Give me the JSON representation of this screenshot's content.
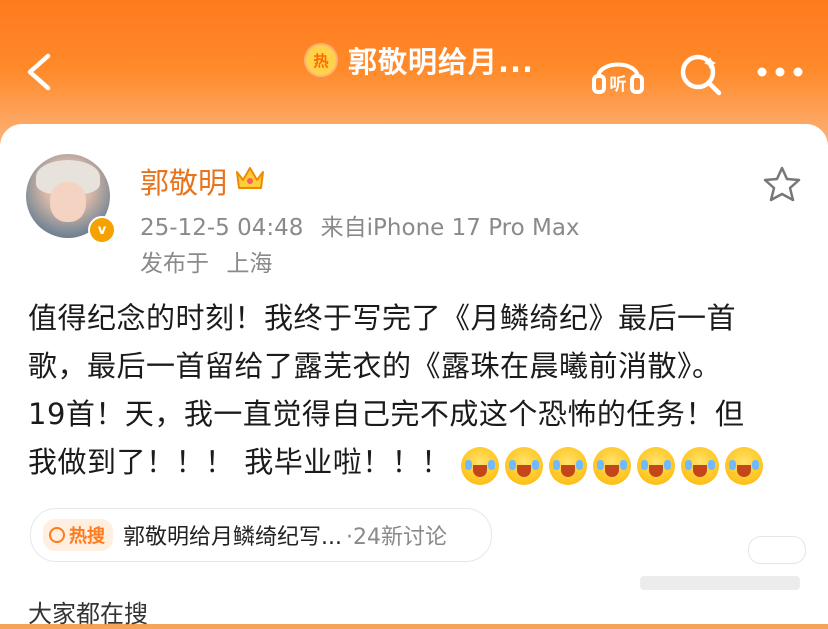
{
  "header": {
    "hot_badge": "热",
    "title": "郭敬明给月...",
    "icons": [
      "back-arrow-icon",
      "listen-icon",
      "search-icon",
      "more-icon"
    ],
    "listen_label": "听",
    "accent_color": "#ff7a1e"
  },
  "post": {
    "username": "郭敬明",
    "timestamp": "25-12-5 04:48",
    "source": "来自iPhone 17 Pro Max",
    "location_prefix": "发布于",
    "location": "上海",
    "content_lines": [
      "值得纪念的时刻！我终于写完了《月鳞绮纪》最后一首",
      "歌，最后一首留给了露芜衣的《露珠在晨曦前消散》。",
      "19首！天，我一直觉得自己完不成这个恐怖的任务！但",
      "我做到了！！！ 我毕业啦！！！"
    ],
    "emoji_count": 7,
    "username_color": "#e8731b"
  },
  "topic": {
    "badge": "热搜",
    "text": "郭敬明给月鳞绮纪写...",
    "count": "·24新讨论"
  },
  "section": {
    "more_search": "大家都在搜"
  }
}
